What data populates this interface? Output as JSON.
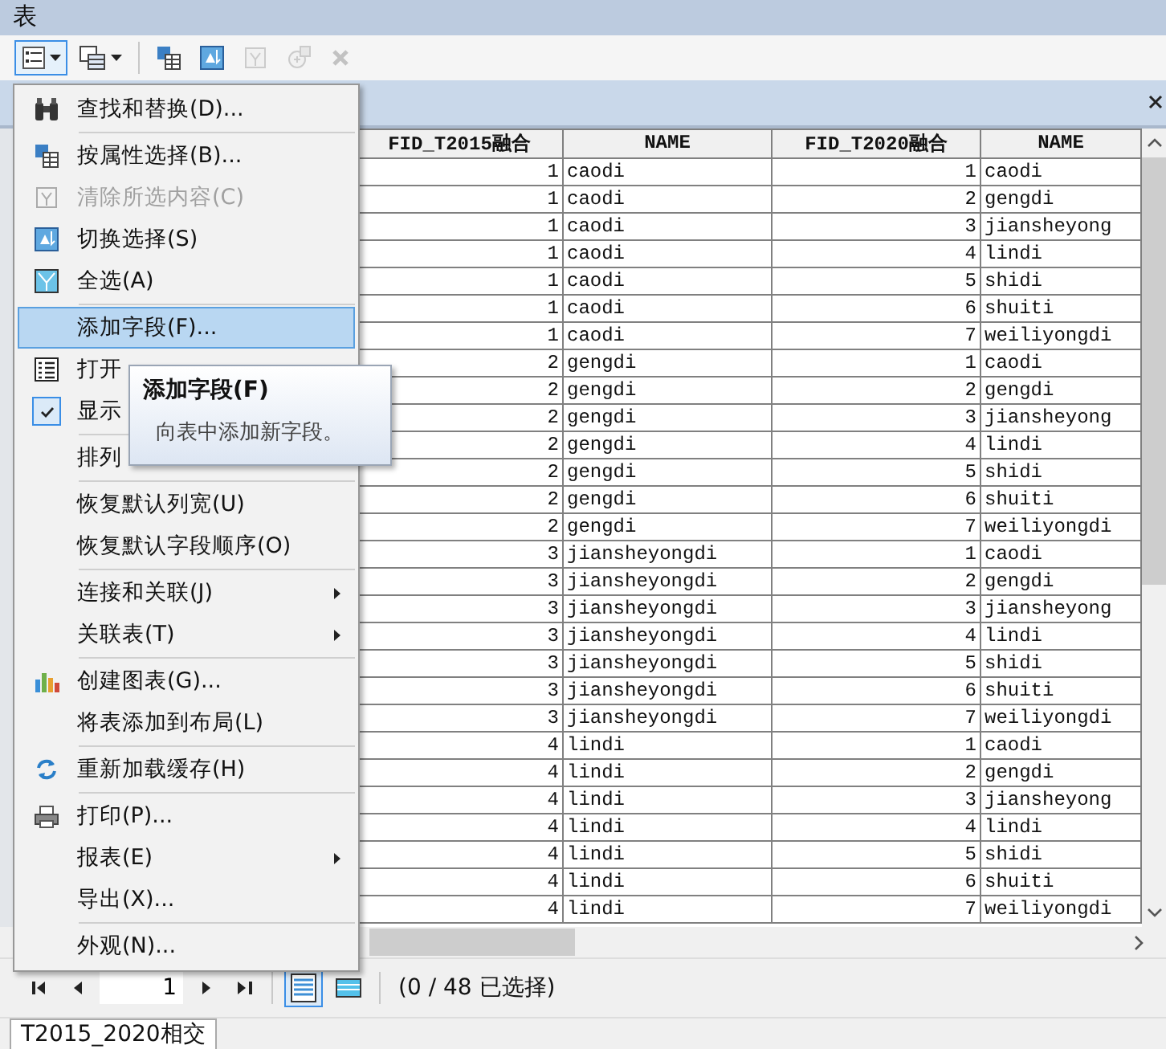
{
  "window": {
    "title": "表"
  },
  "toolbar": [
    {
      "kind": "dropdown",
      "expanded": true,
      "disabled": false
    },
    {
      "kind": "dropdown",
      "expanded": false,
      "disabled": false
    },
    {
      "kind": "button",
      "expanded": false,
      "disabled": false
    },
    {
      "kind": "button",
      "expanded": false,
      "disabled": false
    },
    {
      "kind": "button",
      "expanded": false,
      "disabled": true
    },
    {
      "kind": "button",
      "expanded": false,
      "disabled": true
    },
    {
      "kind": "button",
      "expanded": false,
      "disabled": true
    }
  ],
  "table": {
    "columns": [
      "FID_T2015融合",
      "NAME",
      "FID_T2020融合",
      "NAME"
    ],
    "rows": [
      [
        "1",
        "caodi",
        "1",
        "caodi"
      ],
      [
        "1",
        "caodi",
        "2",
        "gengdi"
      ],
      [
        "1",
        "caodi",
        "3",
        "jiansheyong"
      ],
      [
        "1",
        "caodi",
        "4",
        "lindi"
      ],
      [
        "1",
        "caodi",
        "5",
        "shidi"
      ],
      [
        "1",
        "caodi",
        "6",
        "shuiti"
      ],
      [
        "1",
        "caodi",
        "7",
        "weiliyongdi"
      ],
      [
        "2",
        "gengdi",
        "1",
        "caodi"
      ],
      [
        "2",
        "gengdi",
        "2",
        "gengdi"
      ],
      [
        "2",
        "gengdi",
        "3",
        "jiansheyong"
      ],
      [
        "2",
        "gengdi",
        "4",
        "lindi"
      ],
      [
        "2",
        "gengdi",
        "5",
        "shidi"
      ],
      [
        "2",
        "gengdi",
        "6",
        "shuiti"
      ],
      [
        "2",
        "gengdi",
        "7",
        "weiliyongdi"
      ],
      [
        "3",
        "jiansheyongdi",
        "1",
        "caodi"
      ],
      [
        "3",
        "jiansheyongdi",
        "2",
        "gengdi"
      ],
      [
        "3",
        "jiansheyongdi",
        "3",
        "jiansheyong"
      ],
      [
        "3",
        "jiansheyongdi",
        "4",
        "lindi"
      ],
      [
        "3",
        "jiansheyongdi",
        "5",
        "shidi"
      ],
      [
        "3",
        "jiansheyongdi",
        "6",
        "shuiti"
      ],
      [
        "3",
        "jiansheyongdi",
        "7",
        "weiliyongdi"
      ],
      [
        "4",
        "lindi",
        "1",
        "caodi"
      ],
      [
        "4",
        "lindi",
        "2",
        "gengdi"
      ],
      [
        "4",
        "lindi",
        "3",
        "jiansheyong"
      ],
      [
        "4",
        "lindi",
        "4",
        "lindi"
      ],
      [
        "4",
        "lindi",
        "5",
        "shidi"
      ],
      [
        "4",
        "lindi",
        "6",
        "shuiti"
      ],
      [
        "4",
        "lindi",
        "7",
        "weiliyongdi"
      ]
    ]
  },
  "menu": {
    "groups": [
      [
        {
          "label": "查找和替换(D)...",
          "disabled": false,
          "selected": false,
          "submenu": false
        }
      ],
      [
        {
          "label": "按属性选择(B)...",
          "disabled": false,
          "selected": false,
          "submenu": false
        },
        {
          "label": "清除所选内容(C)",
          "disabled": true,
          "selected": false,
          "submenu": false
        },
        {
          "label": "切换选择(S)",
          "disabled": false,
          "selected": false,
          "submenu": false
        },
        {
          "label": "全选(A)",
          "disabled": false,
          "selected": false,
          "submenu": false
        }
      ],
      [
        {
          "label": "添加字段(F)...",
          "disabled": false,
          "selected": true,
          "submenu": false
        },
        {
          "label": "打开",
          "disabled": false,
          "selected": false
        },
        {
          "label": "显示",
          "disabled": false,
          "selected": false,
          "submenu": false,
          "kind": "check",
          "checked": true
        }
      ],
      [
        {
          "label": "排列",
          "disabled": false,
          "selected": false
        }
      ],
      [
        {
          "label": "恢复默认列宽(U)",
          "disabled": false,
          "selected": false,
          "submenu": false
        },
        {
          "label": "恢复默认字段顺序(O)",
          "disabled": false,
          "selected": false,
          "submenu": false
        }
      ],
      [
        {
          "label": "连接和关联(J)",
          "disabled": false,
          "selected": false,
          "submenu": true
        },
        {
          "label": "关联表(T)",
          "disabled": false,
          "selected": false,
          "submenu": true
        }
      ],
      [
        {
          "label": "创建图表(G)...",
          "disabled": false,
          "selected": false,
          "submenu": false
        },
        {
          "label": "将表添加到布局(L)",
          "disabled": false,
          "selected": false,
          "submenu": false
        }
      ],
      [
        {
          "label": "重新加载缓存(H)",
          "disabled": false,
          "selected": false,
          "submenu": false
        }
      ],
      [
        {
          "label": "打印(P)...",
          "disabled": false,
          "selected": false,
          "submenu": false
        },
        {
          "label": "报表(E)",
          "disabled": false,
          "selected": false,
          "submenu": true
        },
        {
          "label": "导出(X)...",
          "disabled": false,
          "selected": false,
          "submenu": false
        }
      ],
      [
        {
          "label": "外观(N)...",
          "disabled": false,
          "selected": false,
          "submenu": false
        }
      ]
    ]
  },
  "tooltip": {
    "title": "添加字段(F)",
    "text": "向表中添加新字段。"
  },
  "navigation": {
    "page": "1",
    "views": [
      {
        "selected": true
      },
      {
        "selected": false
      }
    ],
    "selection": "(0 / 48 已选择)"
  },
  "table_tab": {
    "label": "T2015_2020相交"
  }
}
